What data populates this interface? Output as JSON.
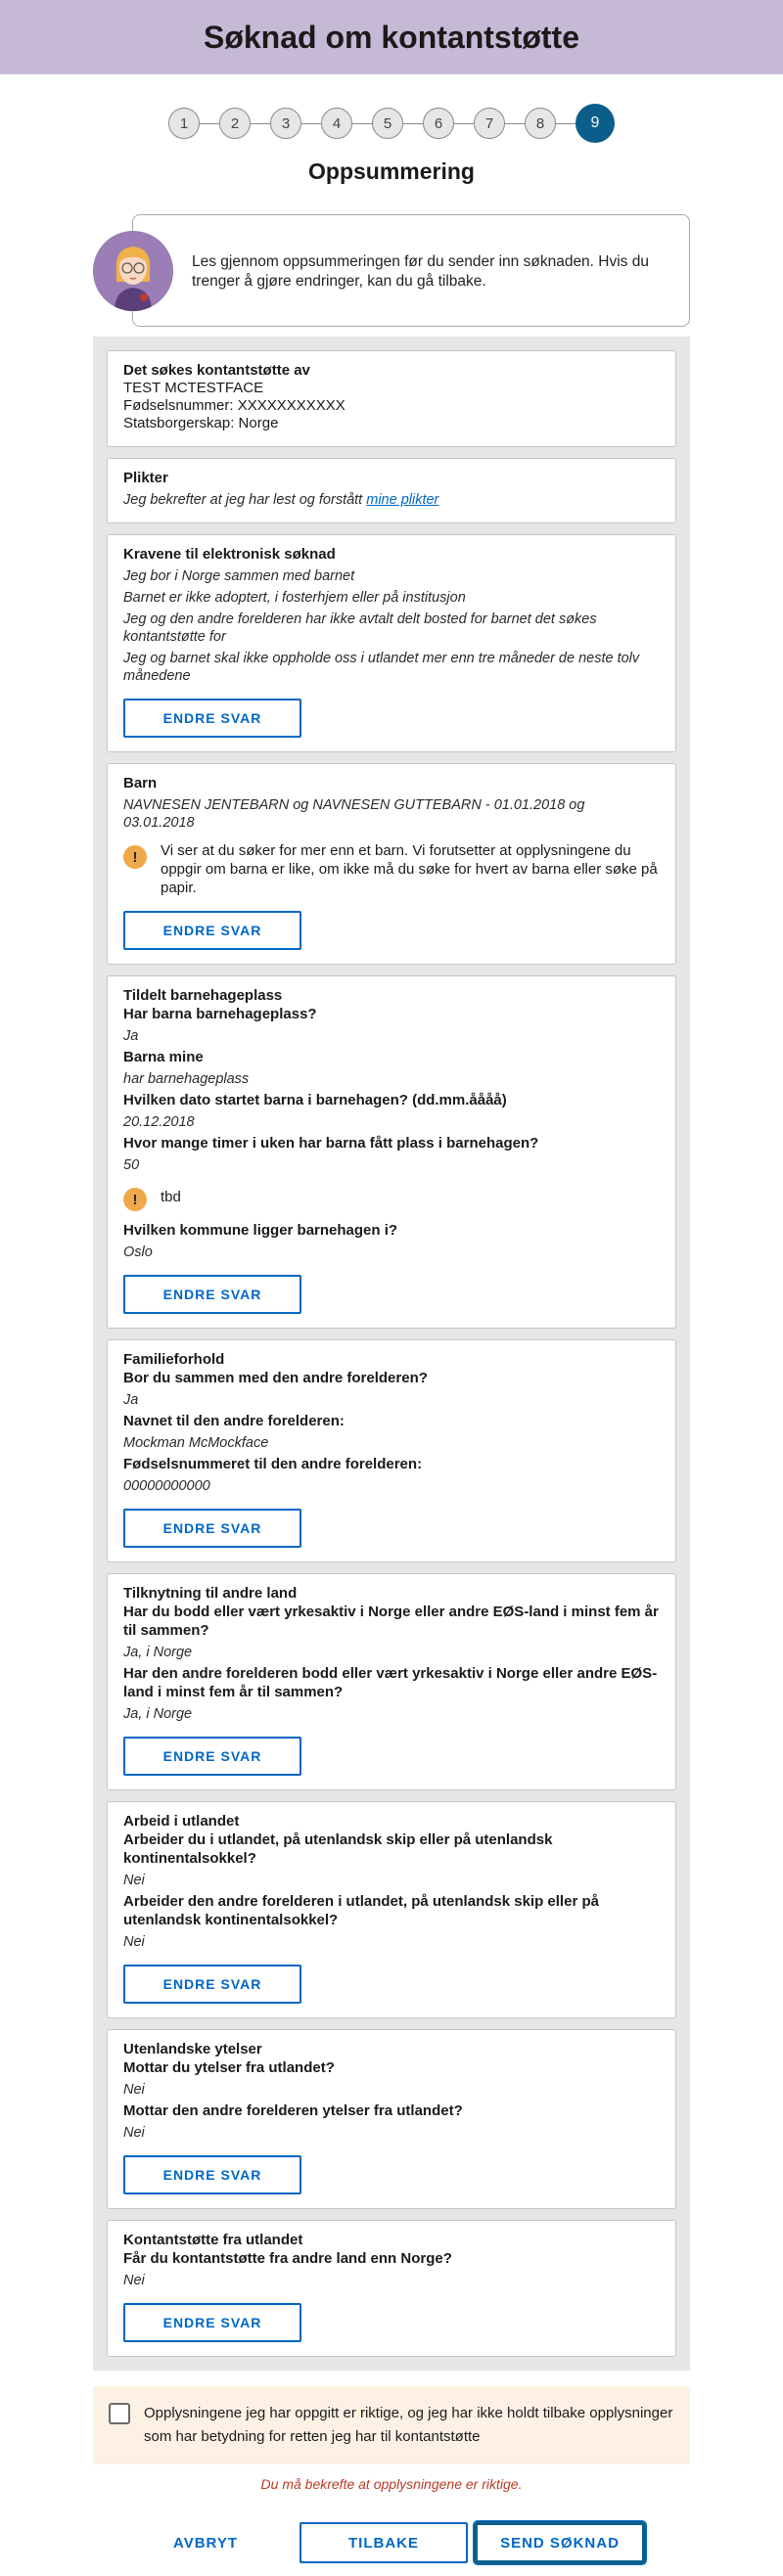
{
  "header": {
    "title": "Søknad om kontantstøtte"
  },
  "stepper": {
    "steps": [
      "1",
      "2",
      "3",
      "4",
      "5",
      "6",
      "7",
      "8",
      "9"
    ],
    "active": "9"
  },
  "page": {
    "step_title": "Oppsummering"
  },
  "intro": {
    "text": "Les gjennom oppsummeringen før du sender inn søknaden. Hvis du trenger å gjøre endringer, kan du gå tilbake."
  },
  "cards": {
    "soker": {
      "title": "Det søkes kontantstøtte av",
      "name": "TEST MCTESTFACE",
      "fnr": "Fødselsnummer: XXXXXXXXXXX",
      "citizenship": "Statsborgerskap: Norge"
    },
    "plikter": {
      "title": "Plikter",
      "text": "Jeg bekrefter at jeg har lest og forstått",
      "link": "mine plikter"
    },
    "krav": {
      "title": "Kravene til elektronisk søknad",
      "items": [
        "Jeg bor i Norge sammen med barnet",
        "Barnet er ikke adoptert, i fosterhjem eller på institusjon",
        "Jeg og den andre forelderen har ikke avtalt delt bosted for barnet det søkes kontantstøtte for",
        "Jeg og barnet skal ikke oppholde oss i utlandet mer enn tre måneder de neste tolv månedene"
      ]
    },
    "barn": {
      "title": "Barn",
      "answer": "NAVNESEN JENTEBARN og NAVNESEN GUTTEBARN - 01.01.2018 og 03.01.2018",
      "alert": "Vi ser at du søker for mer enn et barn. Vi forutsetter at opplysningene du oppgir om barna er like, om ikke må du søke for hvert av barna eller søke på papir."
    },
    "barnehage": {
      "title": "Tildelt barnehageplass",
      "q1": "Har barna barnehageplass?",
      "a1": "Ja",
      "q2": "Barna mine",
      "a2": "har barnehageplass",
      "q3": "Hvilken dato startet barna i barnehagen? (dd.mm.åååå)",
      "a3": "20.12.2018",
      "q4": "Hvor mange timer i uken har barna fått plass i barnehagen?",
      "a4": "50",
      "alert": "tbd",
      "q5": "Hvilken kommune ligger barnehagen i?",
      "a5": "Oslo"
    },
    "familie": {
      "title": "Familieforhold",
      "q1": "Bor du sammen med den andre forelderen?",
      "a1": "Ja",
      "q2": "Navnet til den andre forelderen:",
      "a2": "Mockman McMockface",
      "q3": "Fødselsnummeret til den andre forelderen:",
      "a3": "00000000000"
    },
    "tilknytning": {
      "title": "Tilknytning til andre land",
      "q1": "Har du bodd eller vært yrkesaktiv i Norge eller andre EØS-land i minst fem år til sammen?",
      "a1": "Ja, i Norge",
      "q2": "Har den andre forelderen bodd eller vært yrkesaktiv i Norge eller andre EØS-land i minst fem år til sammen?",
      "a2": "Ja, i Norge"
    },
    "arbeid": {
      "title": "Arbeid i utlandet",
      "q1": "Arbeider du i utlandet, på utenlandsk skip eller på utenlandsk kontinentalsokkel?",
      "a1": "Nei",
      "q2": "Arbeider den andre forelderen i utlandet, på utenlandsk skip eller på utenlandsk kontinentalsokkel?",
      "a2": "Nei"
    },
    "ytelser": {
      "title": "Utenlandske ytelser",
      "q1": "Mottar du ytelser fra utlandet?",
      "a1": "Nei",
      "q2": "Mottar den andre forelderen ytelser fra utlandet?",
      "a2": "Nei"
    },
    "kontantstotte": {
      "title": "Kontantstøtte fra utlandet",
      "q1": "Får du kontantstøtte fra andre land enn Norge?",
      "a1": "Nei"
    }
  },
  "labels": {
    "endre": "ENDRE SVAR"
  },
  "confirm": {
    "text": "Opplysningene jeg har oppgitt er riktige, og jeg har ikke holdt tilbake opplysninger som har betydning for retten jeg har til kontantstøtte",
    "error": "Du må bekrefte at opplysningene er riktige."
  },
  "actions": {
    "cancel": "AVBRYT",
    "back": "TILBAKE",
    "submit": "SEND SØKNAD"
  },
  "colors": {
    "banner": "#c6b9d6",
    "primary": "#0067c5",
    "active_step": "#0c5e8a",
    "alert": "#f0a94a",
    "error": "#ba3a26",
    "confirm_bg": "#fdf1e3"
  }
}
